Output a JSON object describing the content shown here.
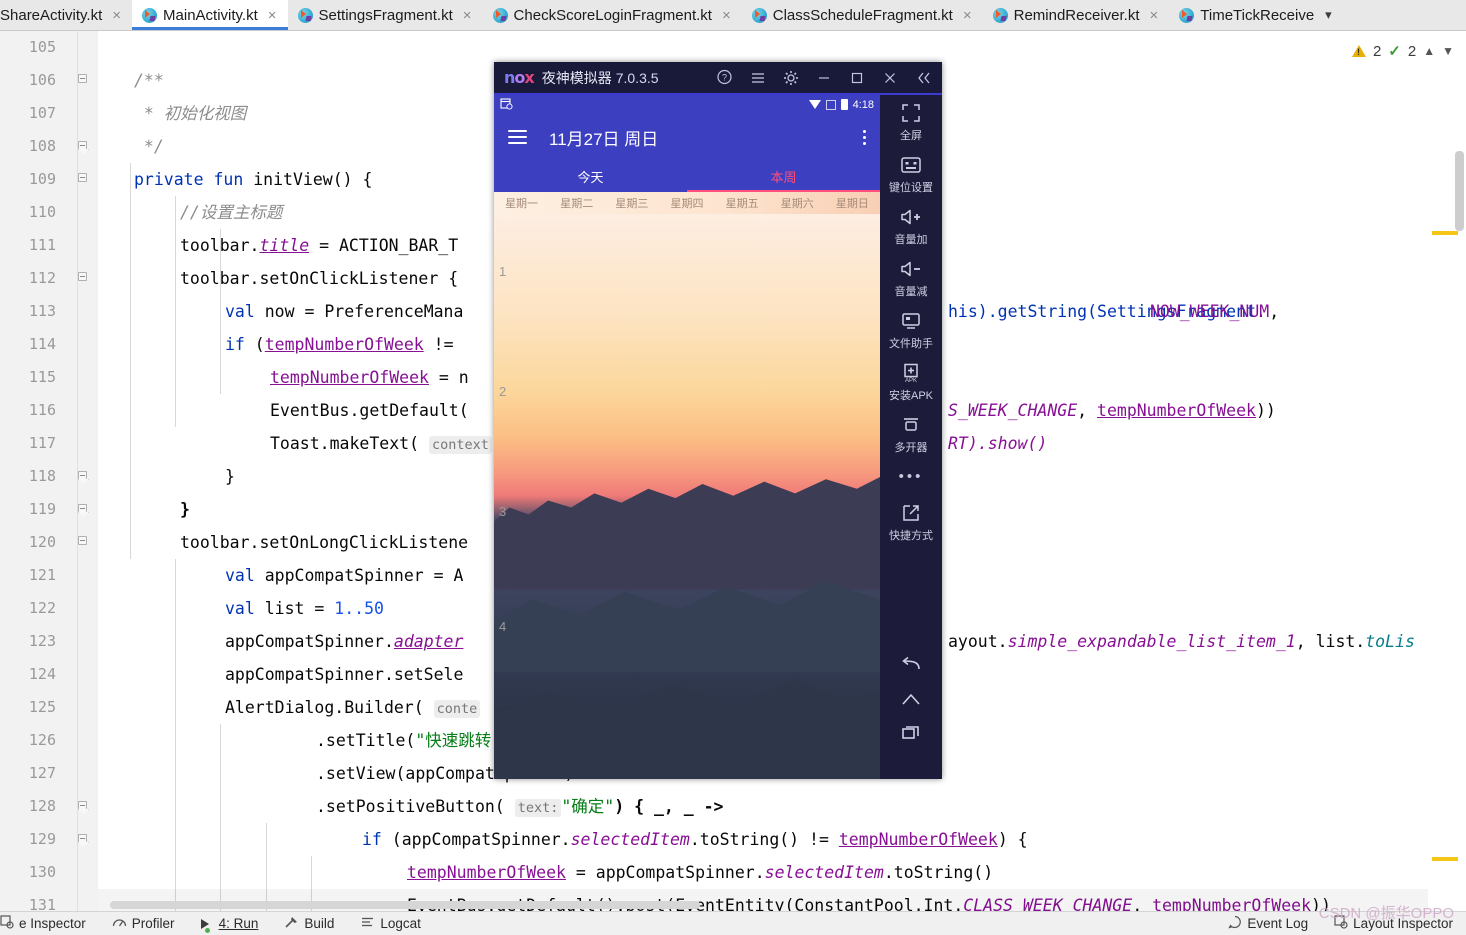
{
  "ide": {
    "tabs": [
      {
        "label": "ShareActivity.kt",
        "active": false,
        "icon": "kotlin-file-icon"
      },
      {
        "label": "MainActivity.kt",
        "active": true,
        "icon": "kotlin-file-icon"
      },
      {
        "label": "SettingsFragment.kt",
        "active": false,
        "icon": "kotlin-file-icon"
      },
      {
        "label": "CheckScoreLoginFragment.kt",
        "active": false,
        "icon": "kotlin-file-icon"
      },
      {
        "label": "ClassScheduleFragment.kt",
        "active": false,
        "icon": "kotlin-file-icon"
      },
      {
        "label": "RemindReceiver.kt",
        "active": false,
        "icon": "kotlin-file-icon"
      },
      {
        "label": "TimeTickReceive",
        "active": false,
        "icon": "kotlin-file-icon"
      }
    ],
    "tab_overflow_label": "⌄",
    "inspection": {
      "warning_count": "2",
      "ok_count": "2",
      "prev_label": "˄",
      "next_label": "˅"
    },
    "line_numbers": [
      "105",
      "106",
      "107",
      "108",
      "109",
      "110",
      "111",
      "112",
      "113",
      "114",
      "115",
      "116",
      "117",
      "118",
      "119",
      "120",
      "121",
      "122",
      "123",
      "124",
      "125",
      "126",
      "127",
      "128",
      "129",
      "130",
      "131"
    ],
    "code_lines": [
      {
        "n": "106",
        "text": "/**"
      },
      {
        "n": "107",
        "text": " * 初始化视图"
      },
      {
        "n": "108",
        "text": " */"
      },
      {
        "n": "109",
        "text": "private fun initView() {"
      },
      {
        "n": "110",
        "text": "//设置主标题"
      },
      {
        "n": "111",
        "text": "toolbar.title = ACTION_BAR_TITLE"
      },
      {
        "n": "112",
        "text": "toolbar.setOnClickListener {"
      },
      {
        "n": "113",
        "text": "val now = PreferenceManager.getDefaultSharedPreferences(this).getString(SettingsFragment.NOW_WEEK_NUM,"
      },
      {
        "n": "114",
        "text": "if (tempNumberOfWeek != now) {"
      },
      {
        "n": "115",
        "text": "tempNumberOfWeek = now"
      },
      {
        "n": "116",
        "text": "EventBus.getDefault().post(EventEntity(ConstantPool.Int.CLASS_WEEK_CHANGE, tempNumberOfWeek))"
      },
      {
        "n": "117",
        "text": "Toast.makeText( context: this, text: \"\", Toast.LENGTH_SHORT).show()"
      },
      {
        "n": "118",
        "text": "}"
      },
      {
        "n": "119",
        "text": "}"
      },
      {
        "n": "120",
        "text": "toolbar.setOnLongClickListener {"
      },
      {
        "n": "121",
        "text": "val appCompatSpinner = AppCompatSpinner(this)"
      },
      {
        "n": "122",
        "text": "val list = 1..50"
      },
      {
        "n": "123",
        "text": "appCompatSpinner.adapter = ArrayAdapter(this, android.R.layout.simple_expandable_list_item_1, list.toList())"
      },
      {
        "n": "124",
        "text": "appCompatSpinner.setSelection(...)"
      },
      {
        "n": "125",
        "text": "AlertDialog.Builder( context: this)"
      },
      {
        "n": "126",
        "text": ".setTitle(\"快速跳转\")"
      },
      {
        "n": "127",
        "text": ".setView(appCompatSpinner)"
      },
      {
        "n": "128",
        "text": ".setPositiveButton( text: \"确定\") { _, _ ->"
      },
      {
        "n": "129",
        "text": "if (appCompatSpinner.selectedItem.toString() != tempNumberOfWeek) {"
      },
      {
        "n": "130",
        "text": "tempNumberOfWeek = appCompatSpinner.selectedItem.toString()"
      },
      {
        "n": "131",
        "text": "EventBus.getDefault().post(EventEntity(ConstantPool.Int.CLASS_WEEK_CHANGE, tempNumberOfWeek))"
      }
    ],
    "tokens": {
      "comment_open": "/**",
      "comment_mid": " * 初始化视图",
      "comment_close": " */",
      "kw_private": "private",
      "kw_fun": "fun",
      "fn_initview": "initView() {",
      "comment_settitle": "//设置主标题",
      "toolbar_dot": "toolbar.",
      "title_prop": "title",
      "eq_actionbar": " = ACTION_BAR_T",
      "toolbar_setonclick": "toolbar.setOnClickListener {",
      "kw_val": "val",
      "now_pref": " now = PreferenceMana",
      "kw_if": "if",
      "paren_open": " (",
      "temp_num": "tempNumberOfWeek",
      "neq_sp": " != ",
      "assign_eq": " = n",
      "eventbus_getdefault": "EventBus.getDefault(",
      "toast_make": "Toast.makeText(",
      "hint_context": "context",
      "brace_close_in": "}",
      "brace_close_out": "}",
      "toolbar_longclick": "toolbar.setOnLongClickListene",
      "appspinner_assign": " appCompatSpinner = A",
      "list_assign": " list = ",
      "range_1_50": "1..50",
      "appspinner_adapter_pre": "appCompatSpinner.",
      "adapter_prop": "adapter",
      "appspinner_setsel": "appCompatSpinner.setSele",
      "alertdialog_builder": "AlertDialog.Builder(",
      "hint_conte": "conte",
      "settitle_pre": ".setTitle(",
      "settitle_str": "\"快速跳转",
      "setview": ".setView(appCompatSpinner)",
      "setpositive_pre": ".setPositiveButton(",
      "hint_text": "text:",
      "str_queding": "\"确定\"",
      "lambda_tail": ") { _, _ ->",
      "if2": "if",
      "appspinner_sel_pre": " (appCompatSpinner.",
      "selecteditem": "selectedItem",
      "tostring_neq": ".toString() != ",
      "brace_open": ") {",
      "temp_assign_pre": " = appCompatSpinner.",
      "tostring_tail": ".toString()",
      "eventbus_post": "EventBus.getDefault().post(EventEntity(ConstantPool.Int.",
      "class_week_change": "CLASS_WEEK_CHANGE",
      "comma_sp": ", ",
      "close2": "))",
      "right_his_get": "his).getString(SettingsFragment.",
      "now_week_num": "NOW_WEEK_NUM",
      "trailing_comma": ",",
      "right_weekchange": "S_WEEK_CHANGE",
      "right_show": "RT).show()",
      "right_layout_pre": "ayout.",
      "right_simple_item": "simple_expandable_list_item_1",
      "right_list_pre": ", list.",
      "right_tolist": "toLis",
      "right_neq_temp": "!= ",
      "right_brace": ") {",
      "right_selected": "ctedItem",
      "right_tostring": ".toString()",
      "right_constantpool": "onstantPool.Int.",
      "right_classweek": "CLASS_WEEK_CHANGE",
      "right_tempnum": "tempNumberOfWeek",
      "right_close": "))"
    },
    "statusbar": {
      "items": [
        {
          "label": "e Inspector",
          "icon": "layout-inspector-icon"
        },
        {
          "label": "Profiler",
          "icon": "profiler-icon"
        },
        {
          "label": "4: Run",
          "icon": "run-icon"
        },
        {
          "label": "Build",
          "icon": "build-hammer-icon"
        },
        {
          "label": "Logcat",
          "icon": "logcat-icon"
        }
      ],
      "right_items": [
        {
          "label": "Event Log",
          "icon": "event-log-icon"
        },
        {
          "label": "Layout Inspector",
          "icon": "layout-inspector-icon"
        }
      ]
    }
  },
  "nox": {
    "logo": {
      "n": "n",
      "o": "o",
      "x": "x"
    },
    "app_name": "夜神模拟器",
    "version": "7.0.3.5",
    "titlebar_buttons": [
      {
        "name": "help-icon",
        "glyph": "?"
      },
      {
        "name": "menu-icon",
        "glyph": "☰"
      },
      {
        "name": "settings-gear-icon",
        "glyph": "⚙"
      },
      {
        "name": "minimize-icon",
        "glyph": "—"
      },
      {
        "name": "maximize-icon",
        "glyph": "□"
      },
      {
        "name": "close-icon",
        "glyph": "✕"
      },
      {
        "name": "collapse-sidebar-icon",
        "glyph": "«"
      }
    ],
    "android": {
      "status_time": "4:18",
      "status_icons": [
        "calendar-notification-icon",
        "wifi-icon",
        "signal-icon",
        "battery-icon"
      ],
      "app_title": "11月27日 周日",
      "menu_icon": "hamburger-icon",
      "overflow_icon": "kebab-menu-icon",
      "tabs": [
        {
          "label": "今天",
          "selected": false
        },
        {
          "label": "本周",
          "selected": true
        }
      ],
      "weekdays": [
        "星期一",
        "星期二",
        "星期三",
        "星期四",
        "星期五",
        "星期六",
        "星期日"
      ],
      "periods": [
        "1",
        "2",
        "3",
        "4"
      ]
    },
    "sidebar": [
      {
        "label": "全屏",
        "icon": "fullscreen-icon"
      },
      {
        "label": "键位设置",
        "icon": "keymapping-icon"
      },
      {
        "label": "音量加",
        "icon": "volume-up-icon"
      },
      {
        "label": "音量减",
        "icon": "volume-down-icon"
      },
      {
        "label": "文件助手",
        "icon": "file-assistant-icon"
      },
      {
        "label": "安装APK",
        "icon": "install-apk-icon"
      },
      {
        "label": "多开器",
        "icon": "multi-instance-icon"
      },
      {
        "label": "",
        "icon": "more-dots-icon"
      },
      {
        "label": "快捷方式",
        "icon": "shortcut-icon"
      }
    ],
    "nav_buttons": [
      {
        "label": "",
        "icon": "back-icon"
      },
      {
        "label": "",
        "icon": "home-icon"
      },
      {
        "label": "",
        "icon": "recents-icon"
      }
    ]
  },
  "watermark": "CSDN @振华OPPO",
  "colors": {
    "accent_blue": "#3b7dd8",
    "nox_purple": "#3b3fc0",
    "tab_selected_pink": "#ff4f7b",
    "warning_yellow": "#e8b007",
    "ok_green": "#3c9a3c"
  }
}
